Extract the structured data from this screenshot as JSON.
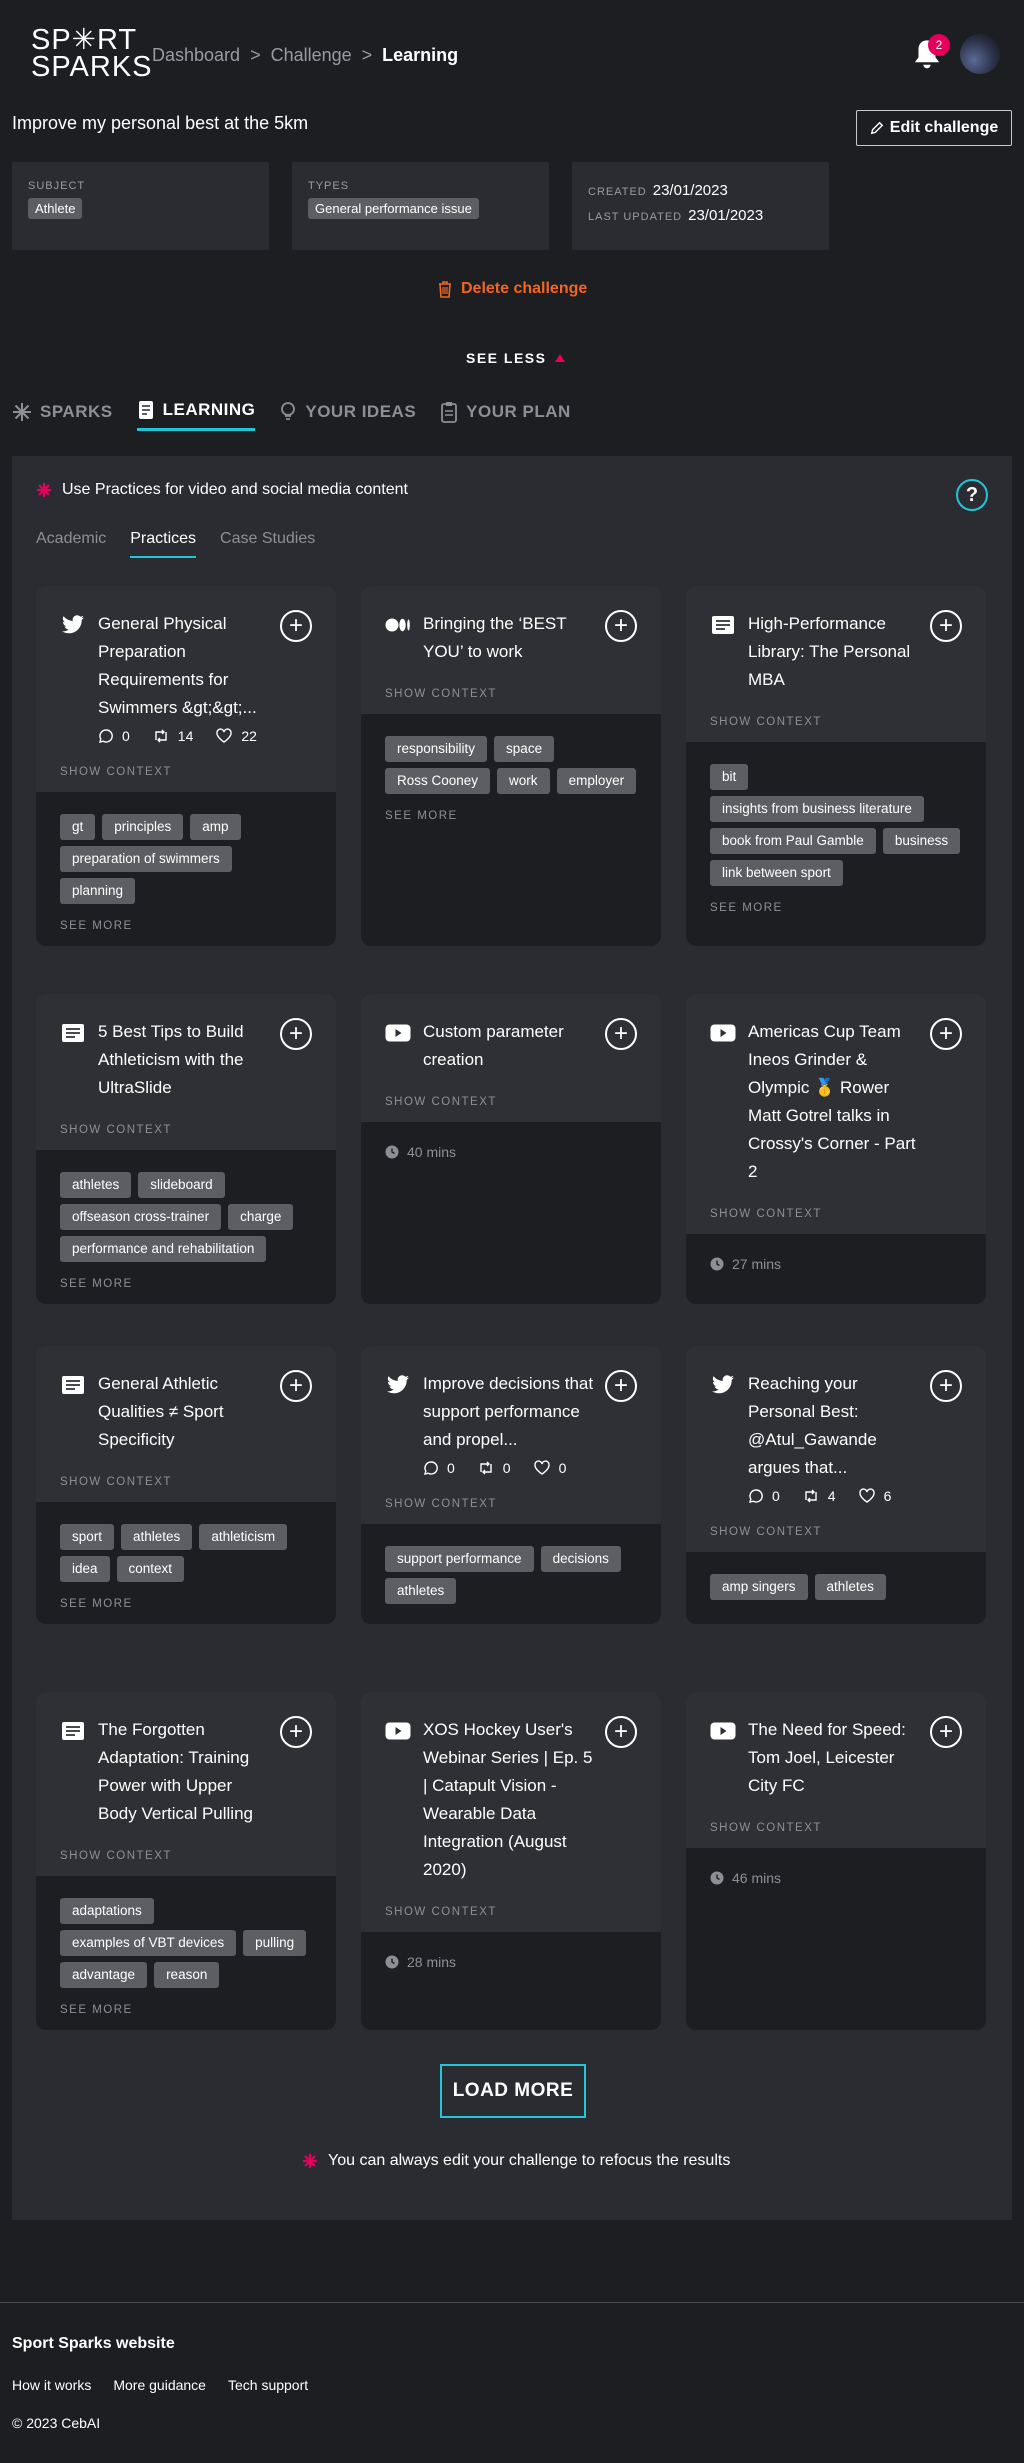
{
  "brand": {
    "logo_line1": "SP✳RT",
    "logo_line2": "SPARKS"
  },
  "breadcrumb": {
    "items": [
      "Dashboard",
      "Challenge"
    ],
    "separator": ">",
    "current": "Learning"
  },
  "notifications": {
    "count": "2"
  },
  "challenge": {
    "title": "Improve my personal best at the 5km",
    "edit_label": "Edit challenge",
    "subject_label": "SUBJECT",
    "subject_value": "Athlete",
    "types_label": "TYPES",
    "types_value": "General performance issue",
    "created_label": "CREATED",
    "created_value": "23/01/2023",
    "updated_label": "LAST UPDATED",
    "updated_value": "23/01/2023",
    "delete_label": "Delete challenge",
    "see_less_label": "SEE LESS"
  },
  "main_tabs": [
    {
      "label": "SPARKS",
      "icon": "spark-icon"
    },
    {
      "label": "LEARNING",
      "icon": "book-icon",
      "active": true
    },
    {
      "label": "YOUR IDEAS",
      "icon": "lightbulb-icon"
    },
    {
      "label": "YOUR PLAN",
      "icon": "clipboard-icon"
    }
  ],
  "panel": {
    "tip": "Use Practices for video and social media content",
    "subtabs": [
      "Academic",
      "Practices",
      "Case Studies"
    ],
    "active_subtab": "Practices",
    "show_context_label": "SHOW CONTEXT",
    "see_more_label": "SEE MORE",
    "load_more_label": "LOAD MORE",
    "bottom_tip": "You can always edit your challenge to refocus the results"
  },
  "cards": [
    {
      "type": "twitter",
      "title": "General Physical Preparation Requirements for Swimmers &gt;&gt;...",
      "stats": {
        "comments": "0",
        "retweets": "14",
        "likes": "22"
      },
      "tags": [
        "gt",
        "principles",
        "amp",
        "preparation of swimmers",
        "planning"
      ]
    },
    {
      "type": "medium",
      "title": "Bringing the ‘BEST YOU’ to work",
      "tags": [
        "responsibility",
        "space",
        "Ross Cooney",
        "work",
        "employer"
      ]
    },
    {
      "type": "article",
      "title": "High-Performance Library: The Personal MBA",
      "tags": [
        "bit",
        "insights from business literature",
        "book from Paul Gamble",
        "business",
        "link between sport"
      ]
    },
    {
      "type": "article",
      "title": "5 Best Tips to Build Athleticism with the UltraSlide",
      "tags": [
        "athletes",
        "slideboard",
        "offseason cross-trainer",
        "charge",
        "performance and rehabilitation"
      ]
    },
    {
      "type": "youtube",
      "title": "Custom parameter creation",
      "duration": "40 mins"
    },
    {
      "type": "youtube",
      "title": "Americas Cup Team Ineos Grinder & Olympic 🥇 Rower Matt Gotrel talks in Crossy's Corner - Part 2",
      "duration": "27 mins"
    },
    {
      "type": "article",
      "title": "General Athletic Qualities ≠ Sport Specificity",
      "tags": [
        "sport",
        "athletes",
        "athleticism",
        "idea",
        "context"
      ]
    },
    {
      "type": "twitter",
      "title": "Improve decisions that support performance and propel...",
      "stats": {
        "comments": "0",
        "retweets": "0",
        "likes": "0"
      },
      "tags": [
        "support performance",
        "decisions",
        "athletes"
      ]
    },
    {
      "type": "twitter",
      "title": "Reaching your Personal Best: @Atul_Gawande argues that...",
      "stats": {
        "comments": "0",
        "retweets": "4",
        "likes": "6"
      },
      "tags": [
        "amp singers",
        "athletes"
      ]
    },
    {
      "type": "article",
      "title": "The Forgotten Adaptation: Training Power with Upper Body Vertical Pulling",
      "tags": [
        "adaptations",
        "examples of VBT devices",
        "pulling",
        "advantage",
        "reason"
      ]
    },
    {
      "type": "youtube",
      "title": "XOS Hockey User's Webinar Series | Ep. 5 | Catapult Vision - Wearable Data Integration (August 2020)",
      "duration": "28 mins"
    },
    {
      "type": "youtube",
      "title": "The Need for Speed: Tom Joel, Leicester City FC",
      "duration": "46 mins"
    }
  ],
  "footer": {
    "title": "Sport Sparks website",
    "links": [
      "How it works",
      "More guidance",
      "Tech support"
    ],
    "copyright": "© 2023 CebAI"
  }
}
